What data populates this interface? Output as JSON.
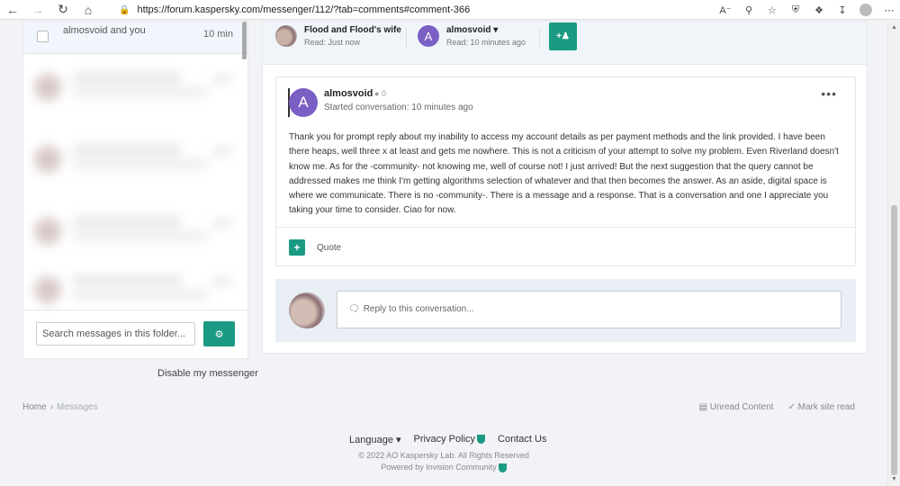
{
  "browser": {
    "url": "https://forum.kaspersky.com/messenger/112/?tab=comments#comment-366"
  },
  "sidebar": {
    "active_item": {
      "name": "almosvoid and you",
      "time": "10 min"
    },
    "search_placeholder": "Search messages in this folder...",
    "disable_link": "Disable my messenger"
  },
  "participants": [
    {
      "name": "Flood and Flood's wife",
      "read": "Read: Just now"
    },
    {
      "name": "almosvoid",
      "avatar_letter": "A",
      "read": "Read: 10 minutes ago"
    }
  ],
  "post": {
    "avatar_letter": "A",
    "author": "almosvoid",
    "reputation": "0",
    "started": "Started conversation: 10 minutes ago",
    "body": "Thank you for prompt reply about my inability to access my account details as per payment methods and the link provided. I have been there heaps, well three x at least and gets me nowhere. This is not a criticism of your attempt to solve my problem. Even Riverland doesn't know me. As for the -community- not knowing me, well of course not! I just arrived! But the next suggestion that the query cannot be addressed makes me think I'm getting algorithms selection of whatever and that then becomes the answer. As an aside, digital space is where we communicate. There is no -community-. There is a message and a response. That is a conversation and one I appreciate you taking your time to consider. Ciao for now.",
    "quote_label": "Quote"
  },
  "reply": {
    "placeholder": "Reply to this conversation..."
  },
  "footer": {
    "breadcrumb": [
      "Home",
      "Messages"
    ],
    "unread": "Unread Content",
    "mark_read": "Mark site read",
    "language": "Language",
    "privacy": "Privacy Policy",
    "contact": "Contact Us",
    "copyright": "© 2022 AO Kaspersky Lab. All Rights Reserved",
    "powered": "Powered by Invision Community"
  },
  "colors": {
    "accent": "#1a9a82",
    "avatar_purple": "#7a5fc4"
  }
}
